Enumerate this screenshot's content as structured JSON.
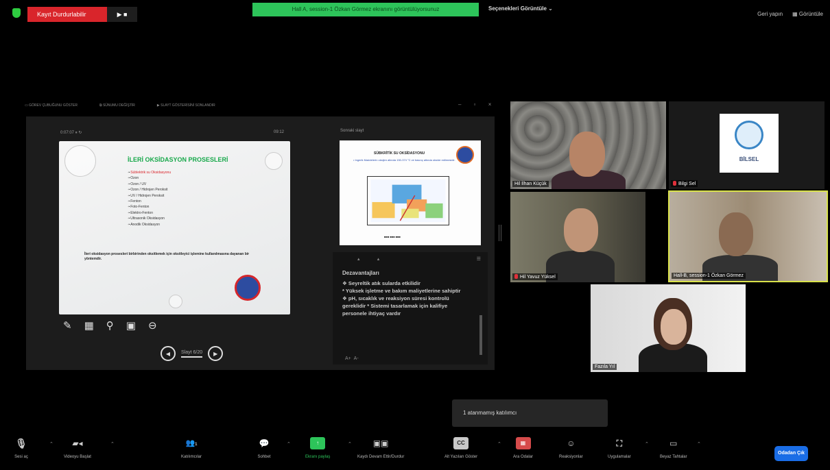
{
  "top_bar": {
    "recording_label": "Kayıt Durdurlabilir",
    "recording_controls": "▶  ■",
    "room_banner": "Hall A, session-1 Özkan Görmez ekranını görüntülüyorsunuz",
    "speaker_view_label": "Seçenekleri Görüntüle",
    "right_items": [
      "Geri yapın",
      "Görüntüle"
    ]
  },
  "share_toolbar": {
    "items": [
      "GÖREV ÇUBUĞUNU GÖSTER",
      "SÜNUMU DEĞİŞTİR",
      "SLAYT GÖSTERİSİNİ SONLANDIR"
    ],
    "window_controls": "– ▫ ×"
  },
  "presenter": {
    "timer": "0:07:07",
    "clock": "09:12",
    "next_slide_label": "Sonraki slayt",
    "slide_title": "İLERİ OKSİDASYON PROSESLERİ",
    "slide_items": [
      "Süblektrik su Oksidasyonu",
      "Ozon",
      "Ozon / UV",
      "Ozon / Hidrojen Peroksit",
      "UV / Hidrojen Peroksit",
      "Fenton",
      "Foto-Fenton",
      "Elektro-Fenton",
      "Ultrasonik Oksidasyon",
      "Anodik Oksidasyon"
    ],
    "slide_footer": "İleri oksidasyon prosesleri birbirinden oksitlemek için oksitleyici işlemine kullanılmasına dayanan bir yöntemdir.",
    "slide_counter": "Slayt 6/20",
    "tools": [
      "✎",
      "▦",
      "⚲",
      "▣",
      "⊖"
    ],
    "next_slide": {
      "title": "SÜBKRİTİK SU OKSİDASYONU",
      "body": "• Ingerik Maddelerin oksijen altında 150-374 °C ve basınç altında okside edilmesidir."
    },
    "notes_header": "Dezavantajları",
    "notes_lines": [
      "❖  Seyreltik atık sularda etkilidir",
      "*  Yüksek işletme ve bakım maliyetlerine sahiptir",
      "❖  pH, sıcaklık ve reaksiyon süresi kontrolü gereklidir    *  Sistemi tasarlamak için kalifiye personele ihtiyaç vardır"
    ]
  },
  "participants": [
    {
      "name": "Hil İlhan Küçük",
      "muted": false
    },
    {
      "name": "Bilgi Sel",
      "muted": true
    },
    {
      "name": "Hil Yavuz Yüksel",
      "muted": true
    },
    {
      "name": "Hall-B, session-1 Özkan Görmez",
      "muted": false
    },
    {
      "name": "Fazıla Yıl",
      "muted": false
    }
  ],
  "bilsel_logo": "BİLSEL",
  "popup": "1 atanmamış katılımcı",
  "toolbar": {
    "items": [
      {
        "label": "Sesi aç",
        "icon": "mic-muted"
      },
      {
        "label": "Videoyu Başlat",
        "icon": "video-off"
      },
      {
        "label": "Katılımcılar",
        "icon": "participants",
        "badge": "1"
      },
      {
        "label": "Sohbet",
        "icon": "chat"
      },
      {
        "label": "Ekranı paylaş",
        "icon": "share-screen",
        "color": "#2dc45a"
      },
      {
        "label": "Kaydı Devam Ettir/Durdur",
        "icon": "record"
      },
      {
        "label": "Alt Yazıları Göster",
        "icon": "cc"
      },
      {
        "label": "Ara Odalar",
        "icon": "breakout-rooms"
      },
      {
        "label": "Reaksiyonlar",
        "icon": "reactions"
      },
      {
        "label": "Uygulamalar",
        "icon": "apps"
      },
      {
        "label": "Beyaz Tahtalar",
        "icon": "whiteboard"
      }
    ],
    "leave_label": "Odadan Çık"
  }
}
